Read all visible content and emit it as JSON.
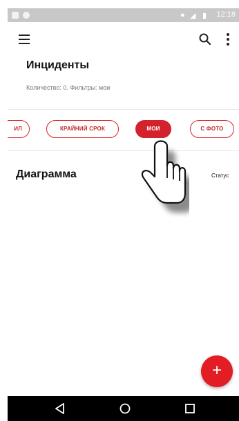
{
  "status_bar": {
    "time": "12:18"
  },
  "toolbar": {
    "menu_icon": "menu-icon",
    "search_icon": "search-icon",
    "more_icon": "more-vert-icon"
  },
  "header": {
    "title": "Инциденты",
    "subtitle": "Количество: 0.  Фильтры: мои"
  },
  "filters": [
    {
      "label": "ИЛ",
      "active": false
    },
    {
      "label": "КРАЙНИЙ СРОК",
      "active": false
    },
    {
      "label": "МОИ",
      "active": true
    },
    {
      "label": "С ФОТО",
      "active": false
    }
  ],
  "main": {
    "section_title": "Диаграмма",
    "status_label": "Статус"
  },
  "fab": {
    "label": "+"
  },
  "colors": {
    "accent": "#d3222c",
    "fab": "#e21d24"
  }
}
